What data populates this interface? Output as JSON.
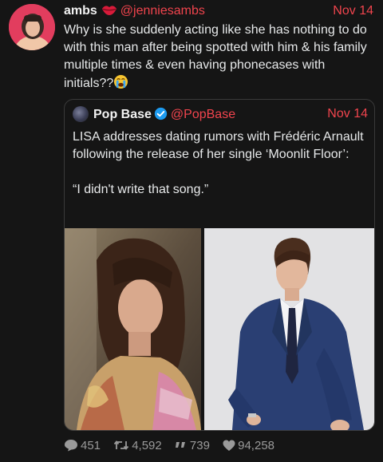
{
  "post": {
    "display_name": "ambs",
    "name_emoji": "lips-icon",
    "handle": "@jenniesambs",
    "date": "Nov 14",
    "text": "Why is she suddenly acting like she has nothing to do with this man after being spotted with him & his family multiple times & even having phonecases with initials??",
    "text_emoji": "loudly-crying-face-icon"
  },
  "quote": {
    "display_name": "Pop Base",
    "verified": true,
    "handle": "@PopBase",
    "date": "Nov 14",
    "text_line1": "LISA addresses dating rumors with Frédéric Arnault following the release of her single ‘Moonlit Floor’:",
    "text_line2": "“I didn't write that song.”",
    "images": [
      "photo-woman-portrait",
      "photo-man-in-suit"
    ]
  },
  "stats": {
    "replies": "451",
    "retweets": "4,592",
    "quotes": "739",
    "likes": "94,258"
  },
  "colors": {
    "background": "#151515",
    "accent": "#f0444d",
    "muted": "#9a9a9a",
    "verified": "#1d9bf0"
  }
}
